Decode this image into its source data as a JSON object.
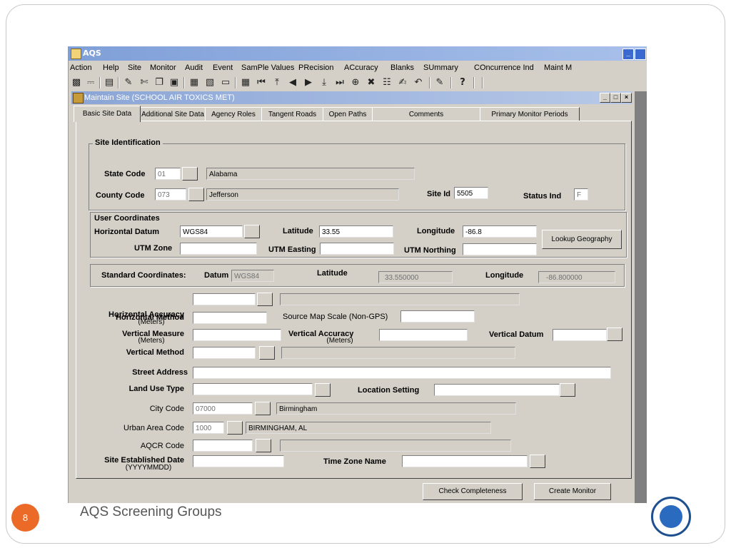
{
  "window": {
    "title": "AQS",
    "min_label": "_"
  },
  "menu": [
    "Action",
    "Help",
    "Site",
    "Monitor",
    "Audit",
    "Event",
    "SamPle Values",
    "PRecision",
    "ACcuracy",
    "Blanks",
    "SUmmary",
    "COncurrence Ind",
    "Maint M"
  ],
  "toolbar_icons": [
    "save-icon",
    "print-icon",
    "exit-icon",
    "edit-icon",
    "cut-icon",
    "copy-icon",
    "paste-icon",
    "insert-record-icon",
    "duplicate-record-icon",
    "delete-record-icon",
    "list-icon",
    "first-record-icon",
    "previous-set-icon",
    "previous-record-icon",
    "next-record-icon",
    "down-icon",
    "next-set-icon",
    "insert-icon",
    "clear-icon",
    "query-icon",
    "edit-query-icon",
    "undo-icon",
    "notes-icon",
    "help-icon"
  ],
  "child": {
    "title": "Maintain Site (SCHOOL AIR TOXICS MET)",
    "min_label": "_",
    "max_label": "□",
    "close_label": "×"
  },
  "tabs": [
    "Basic Site Data",
    "Additional Site Data",
    "Agency Roles",
    "Tangent Roads",
    "Open Paths",
    "Comments",
    "Primary Monitor Periods"
  ],
  "site_identification": {
    "legend": "Site Identification",
    "state_code_label": "State Code",
    "state_code": "01",
    "state_name": "Alabama",
    "county_code_label": "County Code",
    "county_code": "073",
    "county_name": "Jefferson",
    "site_id_label": "Site Id",
    "site_id": "5505",
    "status_ind_label": "Status Ind",
    "status_ind": "F"
  },
  "user_coordinates": {
    "legend": "User Coordinates",
    "horizontal_datum_label": "Horizontal Datum",
    "horizontal_datum": "WGS84",
    "latitude_label": "Latitude",
    "latitude": "33.55",
    "longitude_label": "Longitude",
    "longitude": "-86.8",
    "utm_zone_label": "UTM Zone",
    "utm_zone": "",
    "utm_easting_label": "UTM Easting",
    "utm_easting": "",
    "utm_northing_label": "UTM Northing",
    "utm_northing": "",
    "lookup_button": "Lookup Geography"
  },
  "standard_coordinates": {
    "label": "Standard Coordinates:",
    "datum_label": "Datum",
    "datum": "WGS84",
    "latitude_label": "Latitude",
    "latitude": "33.550000",
    "longitude_label": "Longitude",
    "longitude": "-86.800000"
  },
  "details": {
    "horizontal_method_label": "Horizontal Method",
    "horizontal_method": "",
    "horizontal_method_desc": "",
    "horizontal_accuracy_label": "Horizontal Accuracy",
    "horizontal_accuracy_unit": "(Meters)",
    "horizontal_accuracy": "",
    "source_map_scale_label": "Source Map Scale (Non-GPS)",
    "source_map_scale": "",
    "vertical_measure_label": "Vertical Measure",
    "vertical_measure_unit": "(Meters)",
    "vertical_measure": "",
    "vertical_accuracy_label": "Vertical Accuracy",
    "vertical_accuracy_unit": "(Meters)",
    "vertical_accuracy": "",
    "vertical_datum_label": "Vertical Datum",
    "vertical_datum": "",
    "vertical_method_label": "Vertical Method",
    "vertical_method": "",
    "vertical_method_desc": "",
    "street_address_label": "Street Address",
    "street_address": "",
    "land_use_type_label": "Land Use Type",
    "land_use_type": "",
    "location_setting_label": "Location Setting",
    "location_setting": "",
    "city_code_label": "City Code",
    "city_code": "07000",
    "city_name": "Birmingham",
    "urban_area_code_label": "Urban Area Code",
    "urban_area_code": "1000",
    "urban_area_name": "BIRMINGHAM, AL",
    "aqcr_code_label": "AQCR Code",
    "aqcr_code": "",
    "aqcr_desc": "",
    "site_established_label": "Site Established Date",
    "site_established_format": "(YYYYMMDD)",
    "site_established": "",
    "time_zone_label": "Time Zone Name",
    "time_zone": ""
  },
  "actions": {
    "check_completeness": "Check Completeness",
    "create_monitor": "Create Monitor"
  },
  "footer": {
    "page_number": "8",
    "text": "AQS Screening Groups"
  },
  "colors": {
    "page_number_bg": "#ec6a28",
    "window_face": "#d4d0c8",
    "title_gradient": "#7f9fd8"
  }
}
